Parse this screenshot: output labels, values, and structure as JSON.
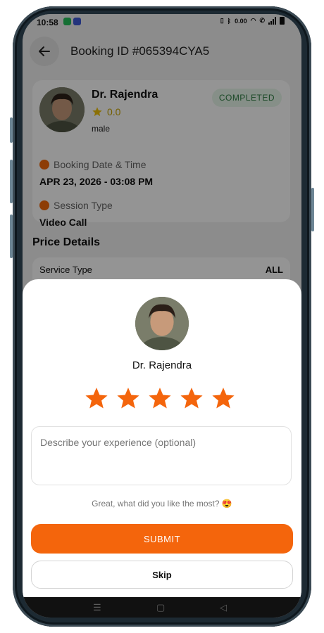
{
  "status_bar": {
    "time": "10:58",
    "net_speed": "0.00"
  },
  "header": {
    "title": "Booking ID #065394CYA5"
  },
  "booking": {
    "doctor_name": "Dr. Rajendra",
    "rating": "0.0",
    "gender": "male",
    "status": "COMPLETED",
    "date_label": "Booking Date & Time",
    "date_value": "APR 23, 2026 - 03:08 PM",
    "session_label": "Session Type",
    "session_value": "Video Call"
  },
  "price": {
    "section_title": "Price Details",
    "rows": [
      {
        "label": "Service Type",
        "value": "ALL"
      }
    ]
  },
  "sheet": {
    "doctor_name": "Dr. Rajendra",
    "star_count": 5,
    "stars_filled": 5,
    "placeholder": "Describe your experience (optional)",
    "prompt": "Great, what did you like the most? 😍",
    "submit_label": "SUBMIT",
    "skip_label": "Skip"
  },
  "colors": {
    "accent": "#f4650c",
    "star": "#f4650c",
    "badge_text": "#2e7d43"
  },
  "icons": [
    "arrow-left-icon",
    "star-icon",
    "clock-icon",
    "session-icon",
    "menu-icon",
    "home-icon",
    "back-icon"
  ]
}
